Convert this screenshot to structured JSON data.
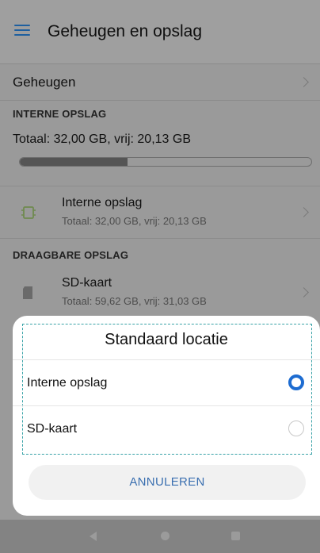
{
  "header": {
    "title": "Geheugen en opslag",
    "menu_icon": "hamburger-menu-icon"
  },
  "geheugen_row": {
    "label": "Geheugen"
  },
  "internal_section": {
    "header": "INTERNE OPSLAG",
    "summary": "Totaal: 32,00 GB, vrij: 20,13 GB",
    "usage_fraction": 0.37
  },
  "internal_item": {
    "name": "Interne opslag",
    "sub": "Totaal: 32,00 GB, vrij: 20,13 GB",
    "icon": "internal-storage-icon"
  },
  "removable_section": {
    "header": "DRAAGBARE OPSLAG"
  },
  "sd_item": {
    "name": "SD-kaart",
    "sub": "Totaal: 59,62 GB, vrij: 31,03 GB",
    "icon": "sd-card-icon"
  },
  "dialog": {
    "title": "Standaard locatie",
    "options": [
      {
        "label": "Interne opslag",
        "selected": true
      },
      {
        "label": "SD-kaart",
        "selected": false
      }
    ],
    "cancel_label": "ANNULEREN",
    "accent_color": "#1d6cd1"
  },
  "navbar": {
    "back_icon": "back-icon",
    "home_icon": "home-icon",
    "recents_icon": "recents-icon"
  }
}
